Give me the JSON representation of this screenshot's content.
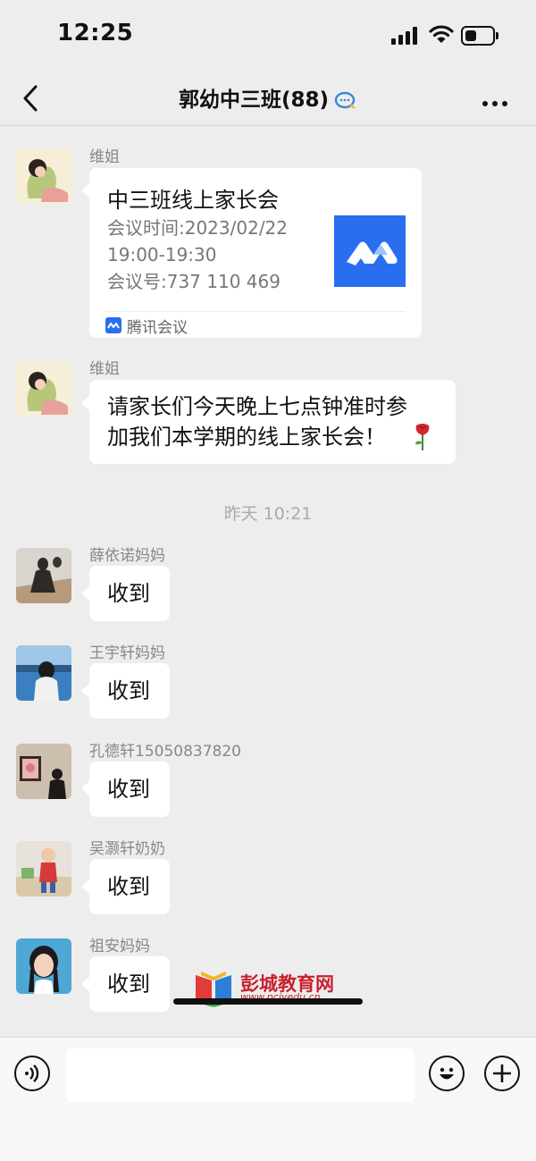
{
  "status_bar": {
    "time": "12:25"
  },
  "header": {
    "title": "郭幼中三班(88)"
  },
  "messages": [
    {
      "sender": "维姐",
      "type": "card",
      "card": {
        "title": "中三班线上家长会",
        "description": "会议时间:2023/02/22\n19:00-19:30\n会议号:737 110 469",
        "source": "腾讯会议"
      }
    },
    {
      "sender": "维姐",
      "type": "text",
      "lines": [
        "请家长们今天晚上七点钟准时参",
        "加我们本学期的线上家长会！"
      ]
    },
    {
      "type": "timestamp",
      "text": "昨天 10:21"
    },
    {
      "sender": "薛依诺妈妈",
      "type": "text",
      "text": "收到"
    },
    {
      "sender": "王宇轩妈妈",
      "type": "text",
      "text": "收到"
    },
    {
      "sender": "孔德轩15050837820",
      "type": "text",
      "text": "收到"
    },
    {
      "sender": "吴灏轩奶奶",
      "type": "text",
      "text": "收到"
    },
    {
      "sender": "祖安妈妈",
      "type": "text",
      "text": "收到"
    }
  ],
  "watermark": {
    "text": "彭城教育网",
    "url": "www.pcjyedu.cn"
  },
  "icons": [
    "back-icon",
    "chat-icon",
    "more-icon",
    "voice-icon",
    "emoji-icon",
    "plus-icon",
    "rose-icon",
    "tencent-meeting-icon"
  ]
}
